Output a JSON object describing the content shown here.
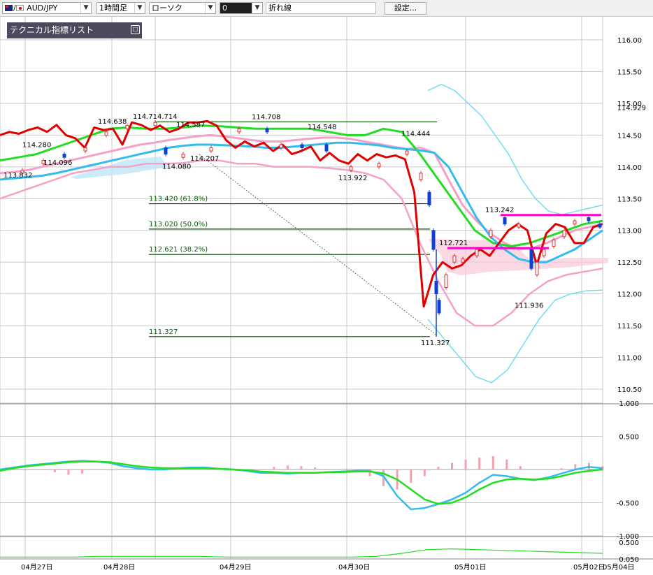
{
  "toolbar": {
    "pair": "AUD/JPY",
    "timeframe": "1時間足",
    "chart_style": "ローソク",
    "line_style_value": "0",
    "line_type": "折れ線",
    "settings_label": "設定..."
  },
  "indicator_list_label": "テクニカル指標リスト",
  "colors": {
    "price_line": "#e00000",
    "bollinger_outer": "#66ddee",
    "bollinger_inner": "#f5a0c8",
    "ma_fast": "#33bbee",
    "ma_slow": "#22dd22",
    "fib_line": "#004d00",
    "support_resistance": "#ff00cc",
    "candle_up": "#e03030",
    "candle_down": "#1040d0",
    "macd_hist": "#f5a0b0",
    "grid": "#c8c8c8"
  },
  "chart_data": [
    {
      "type": "line",
      "ylim": [
        110.5,
        116.0
      ],
      "y_ticks": [
        "116.00",
        "115.50",
        "115.00",
        "114.50",
        "114.00",
        "113.50",
        "113.00",
        "112.50",
        "112.00",
        "111.50",
        "111.00",
        "110.50"
      ],
      "current_price_label": "114.929",
      "x_labels": [
        "04月27日",
        "04月28日",
        "04月29日",
        "04月30日",
        "05月01日",
        "05月02日",
        "05月04日"
      ],
      "fib_levels": [
        {
          "label": "113.420 (61.8%)",
          "value": 113.42
        },
        {
          "label": "113.020 (50.0%)",
          "value": 113.02
        },
        {
          "label": "112.621 (38.2%)",
          "value": 112.621
        },
        {
          "label": "111.327",
          "value": 111.327
        }
      ],
      "fib_top": {
        "label": "114.708",
        "value": 114.708
      },
      "price_annotations": [
        {
          "text": "113.832",
          "value": 113.832
        },
        {
          "text": "114.280",
          "value": 114.28
        },
        {
          "text": "114.096",
          "value": 114.096
        },
        {
          "text": "114.638",
          "value": 114.638
        },
        {
          "text": "114.714.714",
          "value": 114.714
        },
        {
          "text": "114.587",
          "value": 114.587
        },
        {
          "text": "114.080",
          "value": 114.08
        },
        {
          "text": "114.207",
          "value": 114.207
        },
        {
          "text": "114.708",
          "value": 114.708
        },
        {
          "text": "114.548",
          "value": 114.548
        },
        {
          "text": "113.922",
          "value": 113.922
        },
        {
          "text": "114.444",
          "value": 114.444
        },
        {
          "text": "113.242",
          "value": 113.242
        },
        {
          "text": "112.721",
          "value": 112.721
        },
        {
          "text": "111.936",
          "value": 111.936
        },
        {
          "text": "111.327",
          "value": 111.327
        }
      ],
      "support_resistance": [
        113.242,
        112.721
      ],
      "series": [
        {
          "values": [
            114.5,
            114.55,
            114.52,
            114.58,
            114.62,
            114.55,
            114.66,
            114.5,
            114.45,
            114.3,
            114.62,
            114.58,
            114.6,
            114.35,
            114.7,
            114.66,
            114.58,
            114.65,
            114.55,
            114.6,
            114.7,
            114.7,
            114.72,
            114.65,
            114.42,
            114.3,
            114.4,
            114.32,
            114.38,
            114.25,
            114.35,
            114.2,
            114.25,
            114.32,
            114.1,
            114.22,
            114.1,
            114.05,
            114.2,
            114.1,
            114.2,
            114.15,
            114.18,
            114.12,
            113.6,
            111.8,
            112.3,
            112.5,
            112.4,
            112.45,
            112.6,
            112.7,
            112.6,
            112.8,
            113.0,
            113.1,
            113.0,
            112.45,
            112.95,
            113.1,
            113.05,
            112.8,
            112.8,
            113.05,
            113.1
          ]
        },
        {
          "values": [
            113.9,
            113.92,
            113.95,
            114.0,
            114.05,
            114.1,
            114.15,
            114.2,
            114.25,
            114.3,
            114.35,
            114.38,
            114.42,
            114.45,
            114.48,
            114.5,
            114.48,
            114.45,
            114.42,
            114.4,
            114.4,
            114.42,
            114.44,
            114.46,
            114.46,
            114.44,
            114.4,
            114.36,
            114.32,
            114.28,
            114.3,
            114.22,
            113.8,
            113.4,
            113.15,
            112.95,
            112.8,
            112.7,
            112.72,
            112.8,
            112.9,
            113.0,
            113.05,
            113.1
          ]
        },
        {
          "values": [
            113.8,
            113.82,
            113.84,
            113.86,
            113.9,
            113.95,
            114.0,
            114.05,
            114.1,
            114.15,
            114.2,
            114.25,
            114.3,
            114.33,
            114.35,
            114.35,
            114.34,
            114.33,
            114.32,
            114.3,
            114.3,
            114.32,
            114.34,
            114.36,
            114.38,
            114.38,
            114.36,
            114.34,
            114.3,
            114.28,
            114.26,
            114.22,
            114.0,
            113.6,
            113.2,
            112.9,
            112.7,
            112.55,
            112.5,
            112.5,
            112.6,
            112.7,
            112.85,
            113.0
          ]
        },
        {
          "values": [
            114.1,
            114.15,
            114.2,
            114.3,
            114.4,
            114.5,
            114.6,
            114.62,
            114.6,
            114.6,
            114.62,
            114.65,
            114.64,
            114.62,
            114.6,
            114.6,
            114.6,
            114.6,
            114.55,
            114.5,
            114.5,
            114.6,
            114.55,
            114.2,
            113.8,
            113.4,
            113.0,
            112.8,
            112.75,
            112.8,
            112.9,
            113.0,
            113.1,
            113.15
          ]
        },
        {
          "values": [
            113.5,
            113.6,
            113.7,
            113.8,
            113.9,
            113.95,
            114.0,
            114.0,
            114.05,
            114.05,
            114.06,
            114.1,
            114.1,
            114.05,
            114.05,
            114.0,
            114.0,
            114.0,
            113.98,
            113.95,
            113.9,
            113.8,
            113.5,
            112.8,
            112.2,
            111.7,
            111.5,
            111.5,
            111.7,
            112.0,
            112.2,
            112.3,
            112.35,
            112.4
          ]
        },
        {
          "values": [
            115.2,
            115.3,
            115.2,
            115.0,
            114.8,
            114.5,
            114.2,
            113.8,
            113.5,
            113.3,
            113.25,
            113.3,
            113.35,
            113.4
          ]
        },
        {
          "values": [
            111.6,
            111.3,
            111.0,
            110.7,
            110.6,
            110.8,
            111.2,
            111.6,
            111.9,
            112.0,
            112.05,
            112.06
          ]
        }
      ]
    },
    {
      "type": "line",
      "title": "",
      "y_ticks": [
        "1.000",
        "0.500",
        "-0.500",
        "-1.000"
      ],
      "ylim": [
        -1.0,
        1.0
      ],
      "series": [
        {
          "values": [
            0.0,
            0.03,
            0.06,
            0.08,
            0.1,
            0.12,
            0.13,
            0.12,
            0.1,
            0.05,
            0.02,
            0.0,
            0.0,
            0.02,
            0.03,
            0.03,
            0.01,
            0.0,
            -0.02,
            -0.05,
            -0.05,
            -0.06,
            -0.05,
            -0.05,
            -0.04,
            -0.03,
            -0.02,
            -0.02,
            -0.1,
            -0.4,
            -0.6,
            -0.58,
            -0.52,
            -0.45,
            -0.35,
            -0.2,
            -0.08,
            -0.1,
            -0.14,
            -0.16,
            -0.12,
            -0.06,
            0.0,
            0.04,
            0.02
          ]
        },
        {
          "values": [
            -0.02,
            0.02,
            0.05,
            0.07,
            0.09,
            0.11,
            0.12,
            0.12,
            0.11,
            0.08,
            0.05,
            0.03,
            0.02,
            0.02,
            0.02,
            0.02,
            0.01,
            0.0,
            -0.01,
            -0.03,
            -0.04,
            -0.05,
            -0.05,
            -0.05,
            -0.04,
            -0.04,
            -0.03,
            -0.03,
            -0.06,
            -0.15,
            -0.3,
            -0.45,
            -0.52,
            -0.5,
            -0.42,
            -0.3,
            -0.2,
            -0.15,
            -0.14,
            -0.15,
            -0.14,
            -0.1,
            -0.05,
            -0.02,
            0.0
          ]
        },
        {
          "values": [
            0,
            0,
            0,
            0,
            -0.04,
            -0.08,
            -0.06,
            0,
            0,
            0,
            0,
            0.01,
            0.02,
            0.01,
            0,
            0,
            0,
            0,
            0,
            0,
            0.04,
            0.06,
            0.05,
            0.03,
            0,
            0,
            0,
            -0.1,
            -0.25,
            -0.3,
            -0.2,
            -0.1,
            0.04,
            0.1,
            0.15,
            0.18,
            0.2,
            0.15,
            0.05,
            0,
            0,
            0.02,
            0.08,
            0.1,
            0.05
          ]
        }
      ]
    },
    {
      "type": "line",
      "y_ticks": [
        "0.500",
        "0.050"
      ],
      "series": [
        {
          "values": [
            0.1,
            0.1,
            0.1,
            0.1,
            0.12,
            0.12,
            0.12,
            0.12,
            0.12,
            0.1,
            0.1,
            0.1,
            0.1,
            0.1,
            0.1,
            0.12,
            0.2,
            0.3,
            0.32,
            0.3,
            0.28,
            0.26,
            0.24,
            0.22,
            0.2
          ]
        }
      ]
    }
  ]
}
